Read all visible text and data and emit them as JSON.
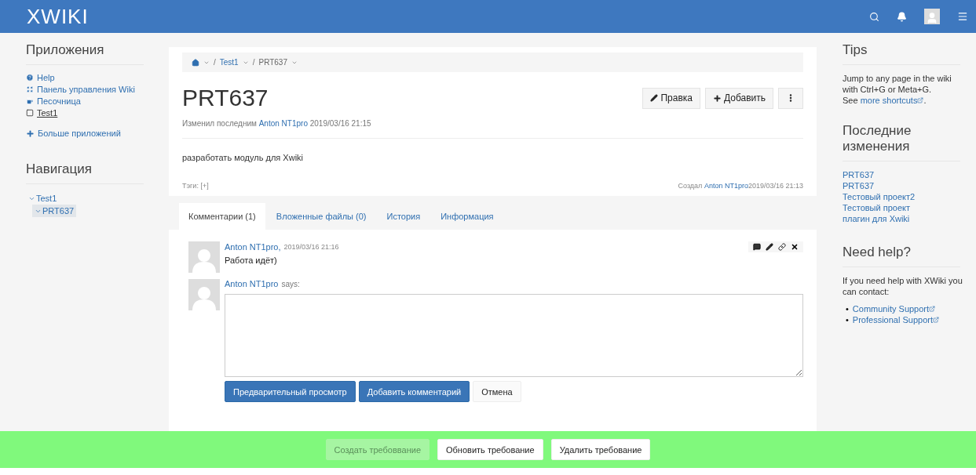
{
  "topbar": {
    "logo": "XWIKI"
  },
  "sidebar": {
    "apps_title": "Приложения",
    "apps": [
      {
        "label": "Help",
        "kind": "help",
        "underlined": false
      },
      {
        "label": "Панель управления Wiki",
        "kind": "grid",
        "underlined": false
      },
      {
        "label": "Песочница",
        "kind": "cup",
        "underlined": false
      },
      {
        "label": "Test1",
        "kind": "square",
        "underlined": true
      }
    ],
    "more_apps": "Больше приложений",
    "nav_title": "Навигация",
    "tree": [
      {
        "label": "Test1",
        "expanded": true,
        "selected": false,
        "children": [
          {
            "label": "PRT637",
            "expanded": true,
            "selected": true
          }
        ]
      }
    ]
  },
  "breadcrumb": [
    {
      "separator": "/",
      "label": "Test1"
    },
    {
      "separator": "/",
      "label": "PRT637"
    }
  ],
  "page": {
    "title": "PRT637",
    "actions": [
      {
        "label": "Правка",
        "kind": "edit"
      },
      {
        "label": "Добавить",
        "kind": "add"
      },
      {
        "kind": "more"
      }
    ],
    "modified_prefix": "Изменил последним",
    "modified_author": "Anton NT1pro",
    "modified_date": "2019/03/16 21:15",
    "content": "разработать модуль для Xwiki",
    "tags_label": "Тэги:",
    "tags_add": "[+]",
    "created_prefix": "Создал",
    "created_author": "Anton NT1pro",
    "created_date": "2019/03/16 21:13"
  },
  "tabs": [
    {
      "label": "Комментарии (1)",
      "selected": true
    },
    {
      "label": "Вложенные файлы (0)",
      "selected": false
    },
    {
      "label": "История",
      "selected": false
    },
    {
      "label": "Информация",
      "selected": false
    }
  ],
  "comments": [
    {
      "author": "Anton NT1pro,",
      "date": "2019/03/16 21:16",
      "text": "Работа идёт)"
    }
  ],
  "new_comment": {
    "author": "Anton NT1pro",
    "says": "says:",
    "buttons": [
      {
        "label": "Предварительный просмотр",
        "primary": true
      },
      {
        "label": "Добавить комментарий",
        "primary": true
      },
      {
        "label": "Отмена",
        "primary": false
      }
    ]
  },
  "right": {
    "tips_title": "Tips",
    "tips_text": "Jump to any page in the wiki with Ctrl+G or Meta+G.",
    "tips_see": "See",
    "tips_link": "more shortcuts",
    "tips_end": ".",
    "recent_title": "Последние изменения",
    "recent": [
      "PRT637",
      "PRT637",
      "Тестовый проект2",
      "Тестовый проект",
      "плагин для Xwiki"
    ],
    "help_title": "Need help?",
    "help_text": "If you need help with XWiki you can contact:",
    "help_links": [
      {
        "bullet": "•",
        "label": "Community Support"
      },
      {
        "bullet": "•",
        "label": "Professional Support"
      }
    ]
  },
  "action_bar": [
    {
      "label": "Создать требоввание",
      "disabled": true
    },
    {
      "label": "Обновить требование",
      "disabled": false
    },
    {
      "label": "Удалить требование",
      "disabled": false
    }
  ]
}
